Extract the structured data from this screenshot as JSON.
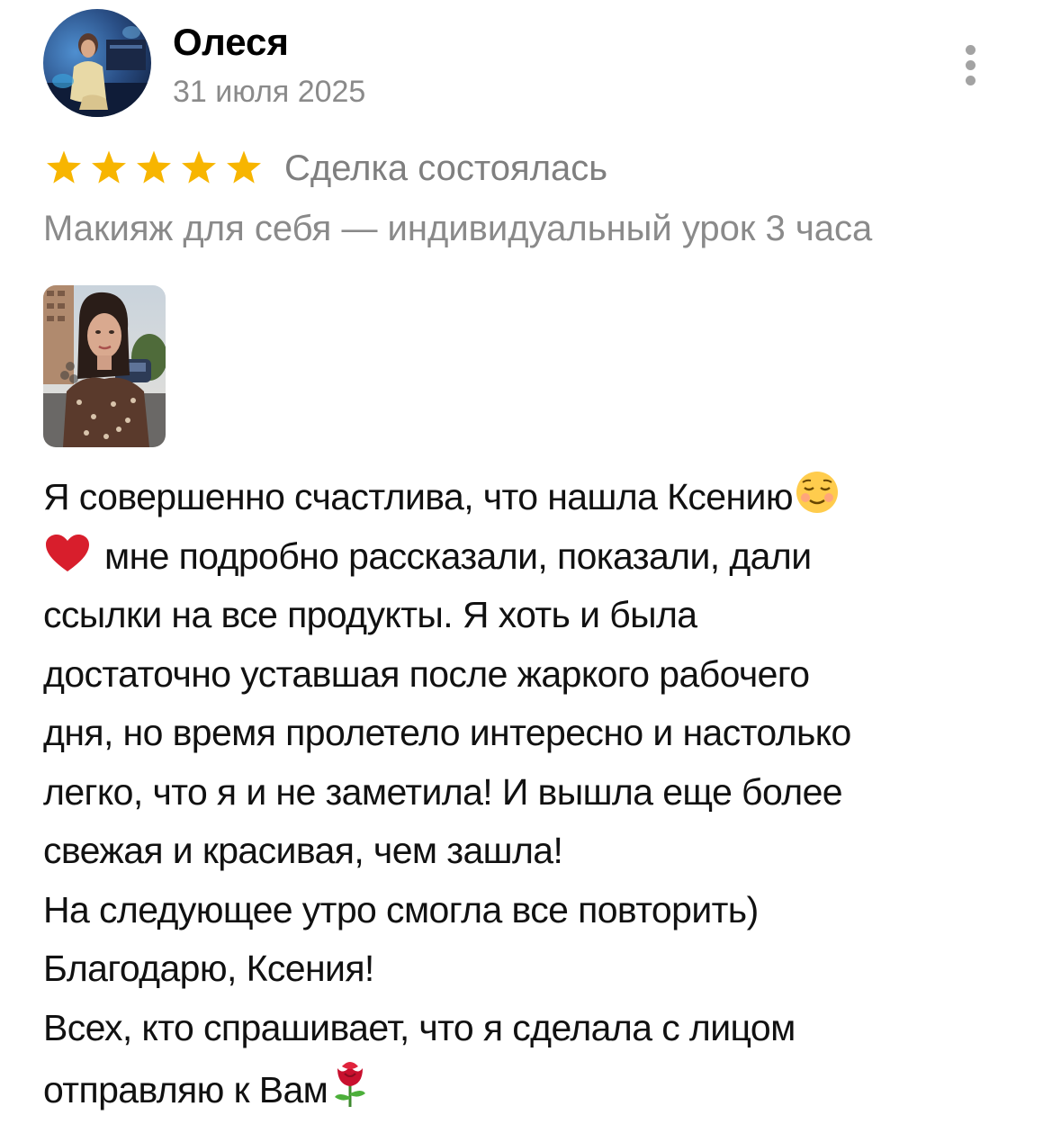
{
  "author": {
    "name": "Олеся",
    "date": "31 июля 2025"
  },
  "rating": {
    "stars": 5,
    "max": 5,
    "star_color": "#F7B500",
    "status": "Сделка состоялась"
  },
  "service": "Макияж для себя — индивидуальный урок 3 часа",
  "icons": {
    "menu": "more-vertical-icon",
    "star": "star-icon",
    "smile": "relieved-face-emoji",
    "heart": "red-heart-emoji",
    "rose": "rose-emoji"
  },
  "review": {
    "lines": [
      "Я совершенно счастлива, что нашла Ксению",
      "мне подробно рассказали, показали, дали",
      "ссылки на все продукты. Я хоть и была",
      "достаточно уставшая после жаркого рабочего",
      "дня, но время пролетело интересно и настолько",
      "легко, что я и не заметила! И вышла еще более",
      "свежая и красивая, чем зашла!",
      "На следующее утро смогла все повторить)",
      "Благодарю, Ксения!",
      "Всех, кто спрашивает, что я сделала с лицом",
      "отправляю к Вам"
    ]
  }
}
